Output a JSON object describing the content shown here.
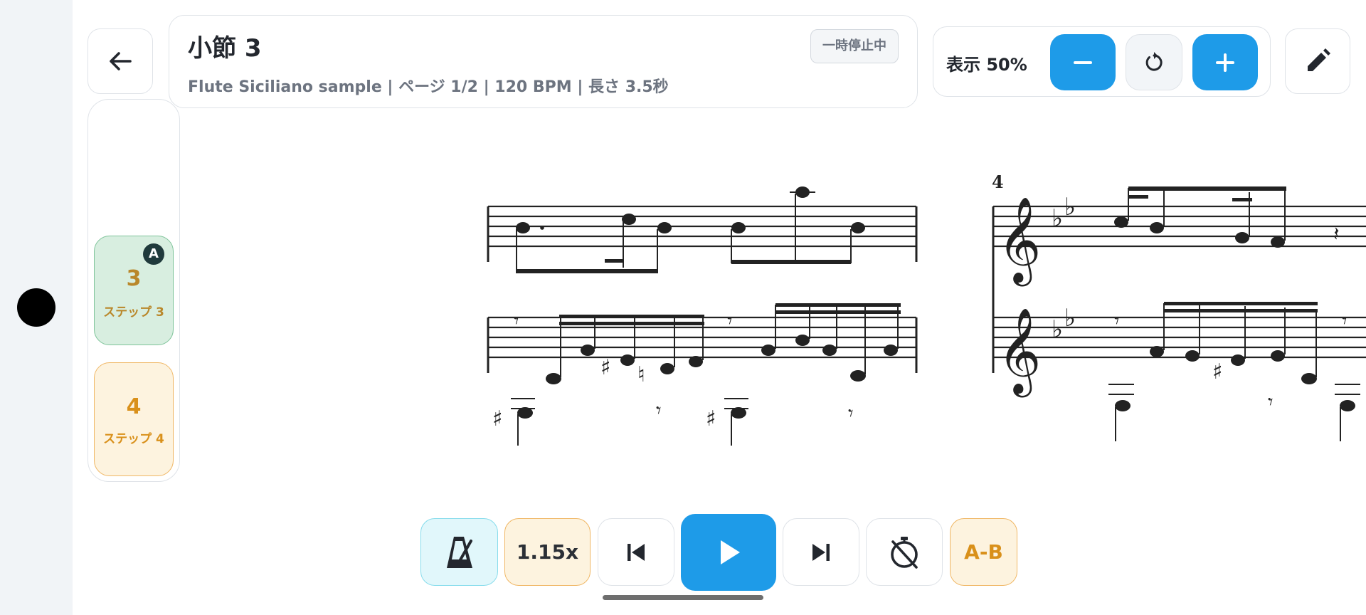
{
  "header": {
    "title": "小節 3",
    "subtitle": "Flute Siciliano sample | ページ 1/2 | 120 BPM | 長さ 3.5秒",
    "status": "一時停止中"
  },
  "zoom": {
    "label": "表示 50%",
    "decrease_icon": "minus-icon",
    "reset_icon": "rotate-icon",
    "increase_icon": "plus-icon"
  },
  "steps": [
    {
      "number": "3",
      "label": "ステップ 3",
      "marker": "A",
      "state": "active"
    },
    {
      "number": "4",
      "label": "ステップ 4",
      "state": "next"
    }
  ],
  "score": {
    "next_measure_number": "4"
  },
  "transport": {
    "metronome_icon": "metronome-icon",
    "speed": "1.15x",
    "prev_icon": "skip-previous-icon",
    "play_icon": "play-icon",
    "next_icon": "skip-next-icon",
    "timer_icon": "timer-off-icon",
    "ab_label": "A-B"
  },
  "colors": {
    "accent_blue": "#1e9be8",
    "active_step_bg": "#d8eee0",
    "next_step_bg": "#fdf3df",
    "step_text": "#d9901a"
  }
}
